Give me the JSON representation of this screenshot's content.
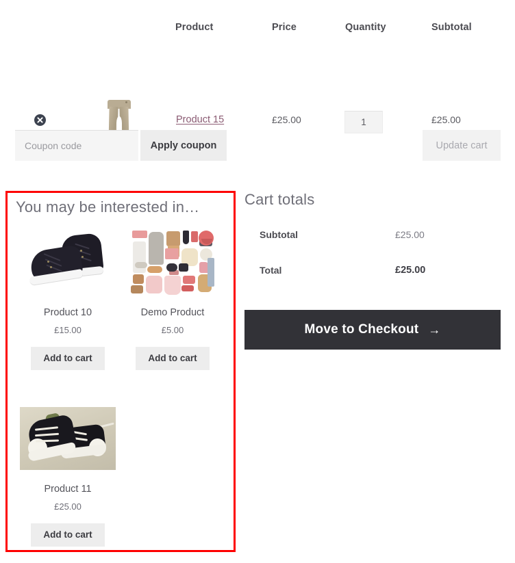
{
  "cart_table": {
    "headers": {
      "product": "Product",
      "price": "Price",
      "quantity": "Quantity",
      "subtotal": "Subtotal"
    },
    "rows": [
      {
        "remove_icon": "remove-circle-x-icon",
        "thumbnail": "beige-trousers-thumbnail",
        "name": "Product 15",
        "price": "£25.00",
        "quantity": "1",
        "subtotal": "£25.00"
      }
    ]
  },
  "coupon": {
    "placeholder": "Coupon code",
    "value": "",
    "apply_label": "Apply coupon",
    "update_label": "Update cart"
  },
  "upsell": {
    "title": "You may be interested in…",
    "border_color": "#fe0000",
    "products": [
      {
        "name": "Product 10",
        "price": "£15.00",
        "button": "Add to cart",
        "image": "black-sneakers-image"
      },
      {
        "name": "Demo Product",
        "price": "£5.00",
        "button": "Add to cart",
        "image": "fashion-collage-image"
      },
      {
        "name": "Product 11",
        "price": "£25.00",
        "button": "Add to cart",
        "image": "converse-sneakers-image"
      }
    ]
  },
  "totals": {
    "title": "Cart totals",
    "rows": [
      {
        "label": "Subtotal",
        "value": "£25.00"
      },
      {
        "label": "Total",
        "value": "£25.00"
      }
    ],
    "checkout_label": "Move to Checkout",
    "checkout_arrow": "→",
    "checkout_bg": "#323237"
  }
}
